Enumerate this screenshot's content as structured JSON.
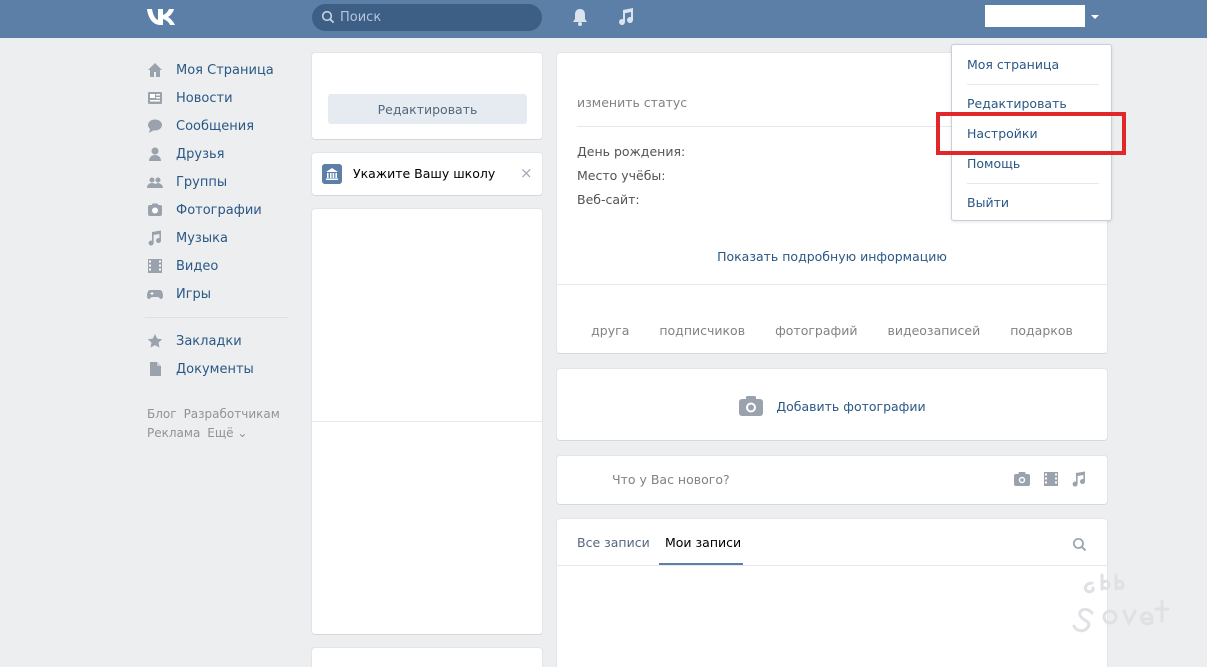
{
  "header": {
    "search_placeholder": "Поиск"
  },
  "left_menu": {
    "items": [
      {
        "label": "Моя Страница",
        "icon": "home-icon"
      },
      {
        "label": "Новости",
        "icon": "news-icon"
      },
      {
        "label": "Сообщения",
        "icon": "messages-icon"
      },
      {
        "label": "Друзья",
        "icon": "friends-icon"
      },
      {
        "label": "Группы",
        "icon": "groups-icon"
      },
      {
        "label": "Фотографии",
        "icon": "photos-icon"
      },
      {
        "label": "Музыка",
        "icon": "music-icon"
      },
      {
        "label": "Видео",
        "icon": "video-icon"
      },
      {
        "label": "Игры",
        "icon": "games-icon"
      }
    ],
    "items2": [
      {
        "label": "Закладки",
        "icon": "star-icon"
      },
      {
        "label": "Документы",
        "icon": "document-icon"
      }
    ],
    "footer": {
      "blog": "Блог",
      "developers": "Разработчикам",
      "ads": "Реклама",
      "more": "Ещё ⌄"
    }
  },
  "profile": {
    "edit_button": "Редактировать",
    "school_prompt": "Укажите Вашу школу",
    "school_close": "×",
    "status": "изменить статус",
    "birthday_label": "День рождения:",
    "study_label": "Место учёбы:",
    "website_label": "Веб-сайт:",
    "more_info": "Показать подробную информацию",
    "counters": [
      "друга",
      "подписчиков",
      "фотографий",
      "видеозаписей",
      "подарков"
    ],
    "add_photos": "Добавить фотографии",
    "whats_new": "Что у Вас нового?",
    "tabs": {
      "all": "Все записи",
      "mine": "Мои записи"
    }
  },
  "dropdown": {
    "my_page": "Моя страница",
    "edit": "Редактировать",
    "settings": "Настройки",
    "help": "Помощь",
    "logout": "Выйти"
  },
  "colors": {
    "header": "#5b7fa6",
    "link": "#2a5885",
    "highlight": "#e0282a"
  }
}
